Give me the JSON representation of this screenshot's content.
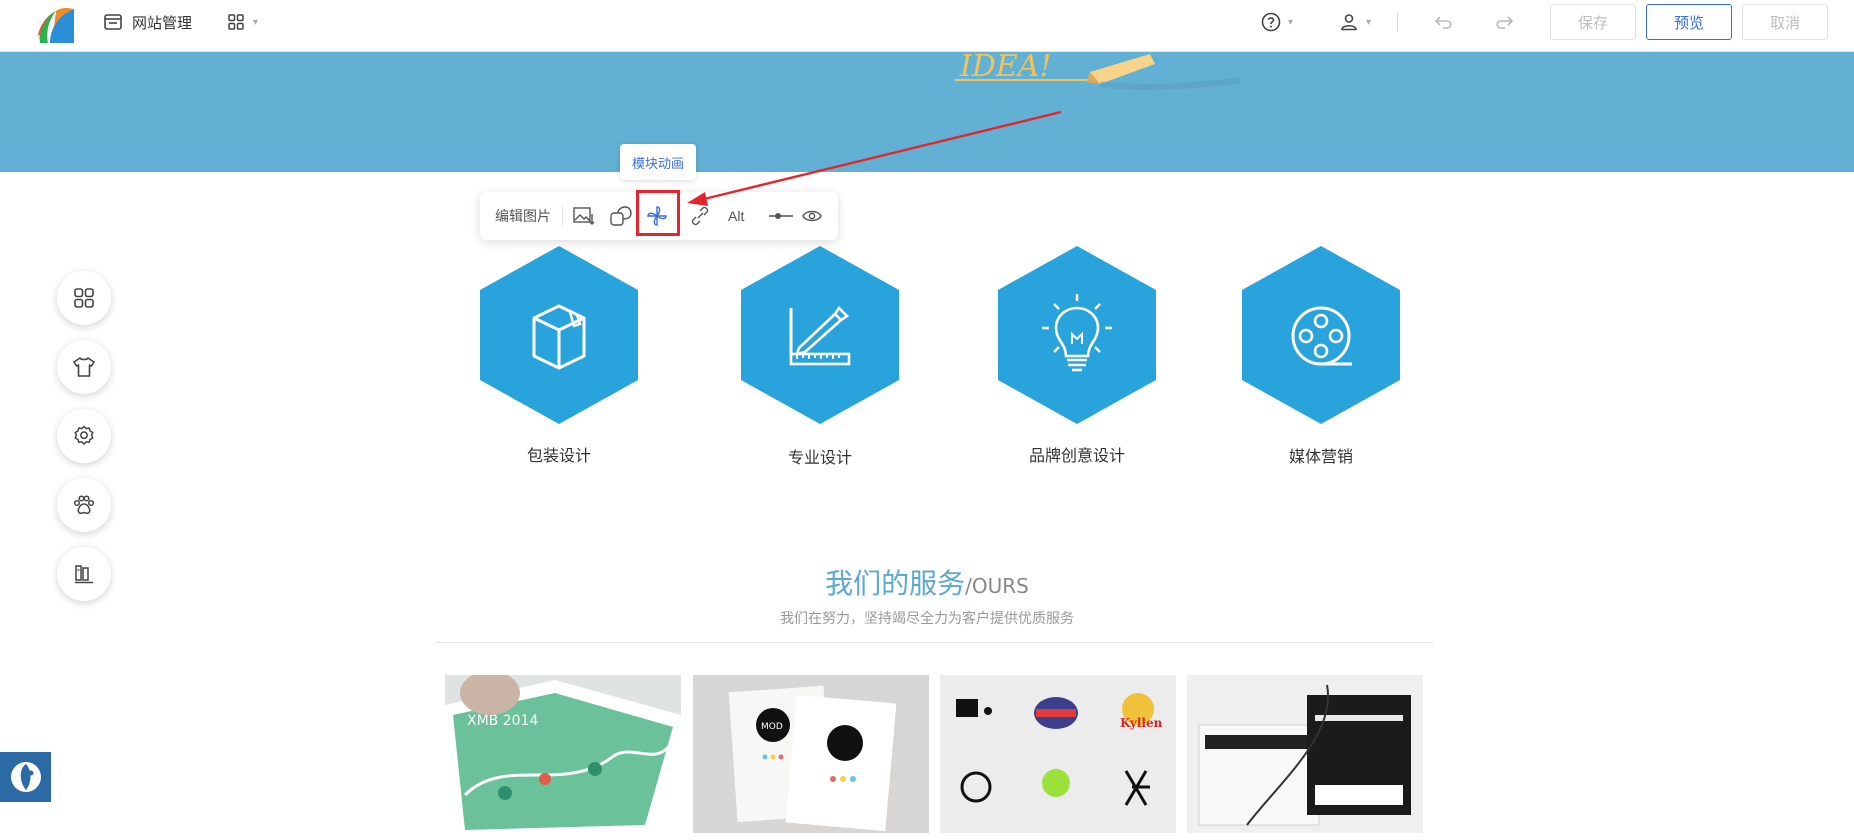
{
  "topbar": {
    "site_manage_label": "网站管理",
    "save_label": "保存",
    "preview_label": "预览",
    "cancel_label": "取消"
  },
  "banner": {
    "art_text": "IDEA!"
  },
  "image_toolbar": {
    "edit_label": "编辑图片",
    "alt_label": "Alt",
    "tooltip": "模块动画"
  },
  "services": [
    {
      "label": "包装设计",
      "icon": "package-box-icon"
    },
    {
      "label": "专业设计",
      "icon": "ruler-pen-icon"
    },
    {
      "label": "品牌创意设计",
      "icon": "lightbulb-icon"
    },
    {
      "label": "媒体营销",
      "icon": "film-reel-icon"
    }
  ],
  "services_heading": {
    "title": "我们的服务",
    "title_en": "/OURS",
    "subtitle": "我们在努力，坚持竭尽全力为客户提供优质服务"
  },
  "gallery": [
    {
      "name": "brochure-thumbnail",
      "text": "XMB 2014"
    },
    {
      "name": "business-cards-thumbnail",
      "text": "MOD"
    },
    {
      "name": "logos-thumbnail",
      "text": "Kyllen"
    },
    {
      "name": "packaging-thumbnail",
      "text": ""
    }
  ],
  "colors": {
    "accent": "#3a6fd8",
    "hex_fill": "#29a3dc",
    "banner": "#62b0d3",
    "highlight": "#e3262e"
  }
}
